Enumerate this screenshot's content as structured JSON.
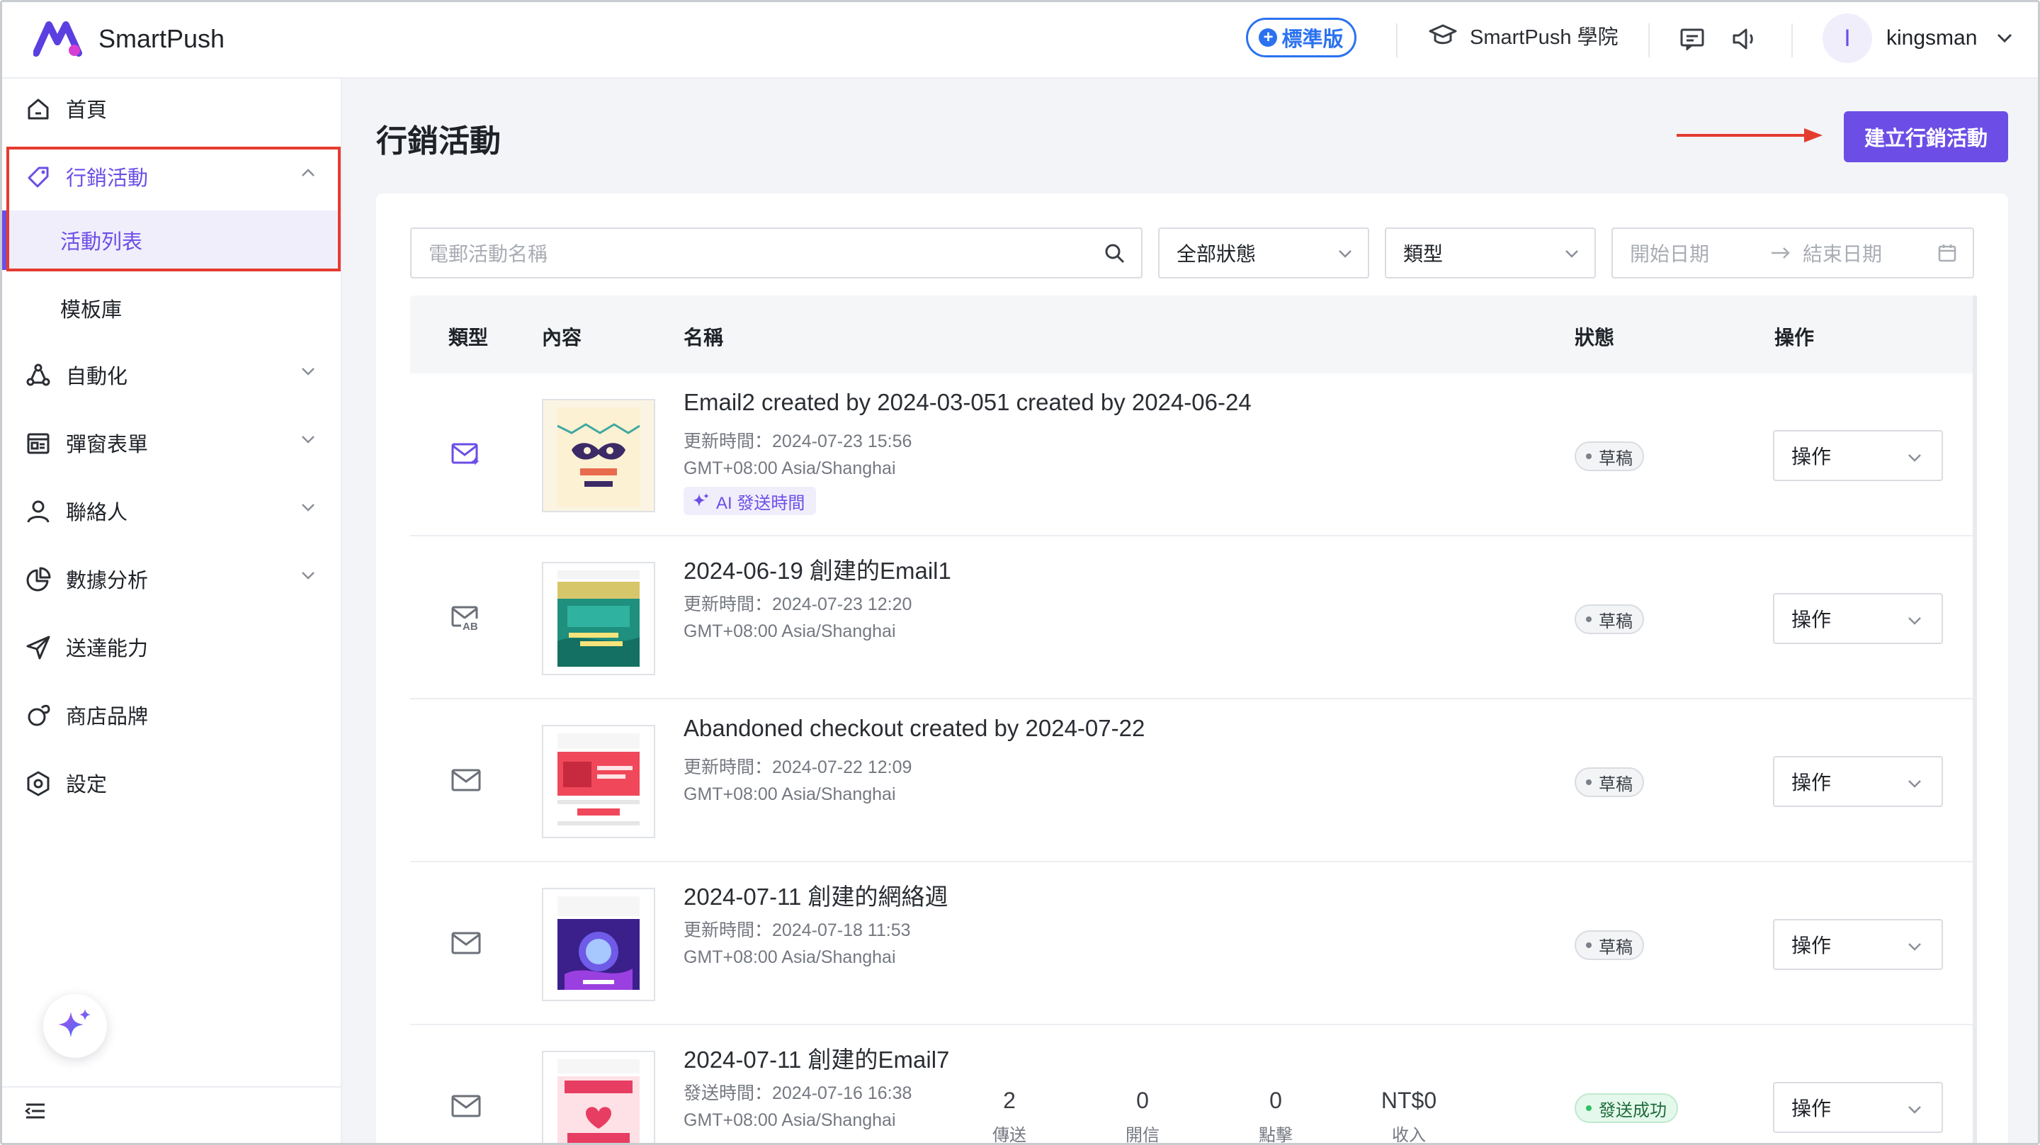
{
  "brand": {
    "name": "SmartPush",
    "accent": "#6c4ee6"
  },
  "header": {
    "plan_badge": "標準版",
    "academy": "SmartPush 學院",
    "user": {
      "avatar_letter": "I",
      "name": "kingsman"
    }
  },
  "sidebar": {
    "items": [
      {
        "label": "首頁",
        "icon": "home-icon"
      },
      {
        "label": "行銷活動",
        "icon": "tag-icon",
        "active": true
      },
      {
        "label": "自動化",
        "icon": "automation-icon"
      },
      {
        "label": "彈窗表單",
        "icon": "form-icon"
      },
      {
        "label": "聯絡人",
        "icon": "user-icon"
      },
      {
        "label": "數據分析",
        "icon": "chart-pie-icon"
      },
      {
        "label": "送達能力",
        "icon": "send-icon"
      },
      {
        "label": "商店品牌",
        "icon": "brand-icon"
      },
      {
        "label": "設定",
        "icon": "settings-icon"
      }
    ],
    "subitems": [
      {
        "label": "活動列表",
        "selected": true
      },
      {
        "label": "模板庫"
      }
    ]
  },
  "main": {
    "title": "行銷活動",
    "create_button": "建立行銷活動",
    "filters": {
      "search_placeholder": "電郵活動名稱",
      "status_select": "全部狀態",
      "type_select": "類型",
      "start_date_placeholder": "開始日期",
      "end_date_placeholder": "結束日期"
    },
    "table": {
      "columns": [
        "類型",
        "內容",
        "名稱",
        "狀態",
        "操作"
      ],
      "action_label": "操作",
      "rows": [
        {
          "type_icon": "email-ai-icon",
          "name": "Email2 created by 2024-03-051 created by 2024-06-24",
          "time_label": "更新時間：",
          "time": "2024-07-23 15:56",
          "timezone": "GMT+08:00 Asia/Shanghai",
          "ai_tag": "AI 發送時間",
          "status": "草稿",
          "thumb": "carnival"
        },
        {
          "type_icon": "ab-test-icon",
          "name": "2024-06-19 創建的Email1",
          "time_label": "更新時間：",
          "time": "2024-07-23 12:20",
          "timezone": "GMT+08:00 Asia/Shanghai",
          "status": "草稿",
          "thumb": "summer"
        },
        {
          "type_icon": "email-icon",
          "name": "Abandoned checkout created by 2024-07-22",
          "time_label": "更新時間：",
          "time": "2024-07-22 12:09",
          "timezone": "GMT+08:00 Asia/Shanghai",
          "status": "草稿",
          "thumb": "checkout"
        },
        {
          "type_icon": "email-icon",
          "name": "2024-07-11 創建的網絡週",
          "time_label": "更新時間：",
          "time": "2024-07-18 11:53",
          "timezone": "GMT+08:00 Asia/Shanghai",
          "status": "草稿",
          "thumb": "cyber"
        },
        {
          "type_icon": "email-icon",
          "name": "2024-07-11 創建的Email7",
          "time_label": "發送時間：",
          "time": "2024-07-16 16:38",
          "timezone": "GMT+08:00 Asia/Shanghai",
          "status": "發送成功",
          "thumb": "valentine",
          "metrics": [
            {
              "value": "2",
              "label": "傳送"
            },
            {
              "value": "0",
              "label": "開信"
            },
            {
              "value": "0",
              "label": "點擊"
            },
            {
              "value": "NT$0",
              "label": "收入"
            }
          ]
        }
      ]
    }
  }
}
